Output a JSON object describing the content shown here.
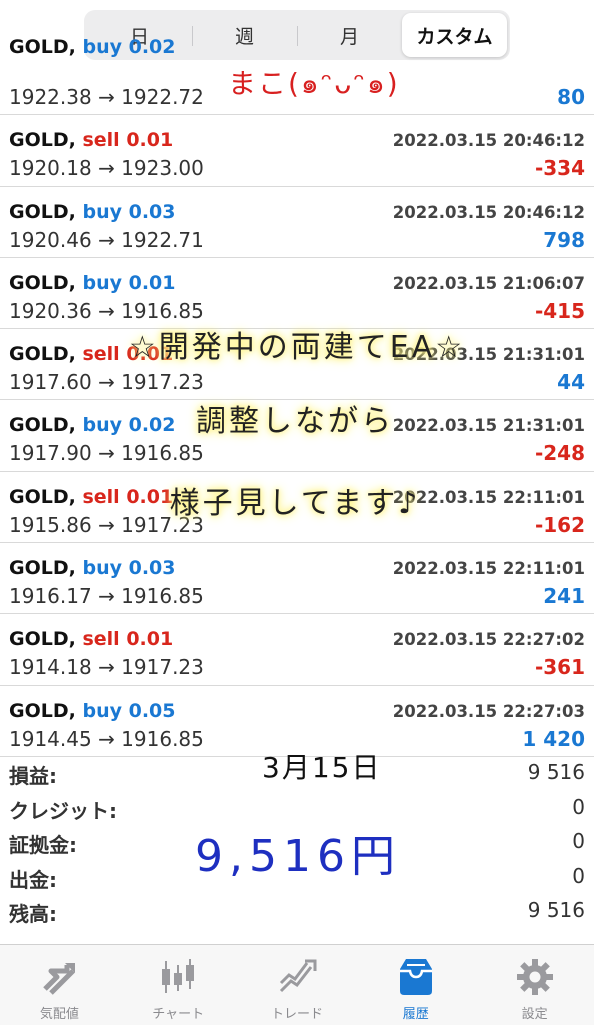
{
  "segments": [
    {
      "label": "日",
      "active": false
    },
    {
      "label": "週",
      "active": false
    },
    {
      "label": "月",
      "active": false
    },
    {
      "label": "カスタム",
      "active": true
    }
  ],
  "trades": [
    {
      "symbol": "GOLD,",
      "side": "buy",
      "lots": "0.02",
      "time": "",
      "prices": "1922.38 → 1922.72",
      "profit": "80",
      "sign": "pos"
    },
    {
      "symbol": "GOLD,",
      "side": "sell",
      "lots": "0.01",
      "time": "2022.03.15 20:46:12",
      "prices": "1920.18 → 1923.00",
      "profit": "-334",
      "sign": "neg"
    },
    {
      "symbol": "GOLD,",
      "side": "buy",
      "lots": "0.03",
      "time": "2022.03.15 20:46:12",
      "prices": "1920.46 → 1922.71",
      "profit": "798",
      "sign": "pos"
    },
    {
      "symbol": "GOLD,",
      "side": "buy",
      "lots": "0.01",
      "time": "2022.03.15 21:06:07",
      "prices": "1920.36 → 1916.85",
      "profit": "-415",
      "sign": "neg"
    },
    {
      "symbol": "GOLD,",
      "side": "sell",
      "lots": "0.01",
      "time": "2022.03.15 21:31:01",
      "prices": "1917.60 → 1917.23",
      "profit": "44",
      "sign": "pos"
    },
    {
      "symbol": "GOLD,",
      "side": "buy",
      "lots": "0.02",
      "time": "2022.03.15 21:31:01",
      "prices": "1917.90 → 1916.85",
      "profit": "-248",
      "sign": "neg"
    },
    {
      "symbol": "GOLD,",
      "side": "sell",
      "lots": "0.01",
      "time": "2022.03.15 22:11:01",
      "prices": "1915.86 → 1917.23",
      "profit": "-162",
      "sign": "neg"
    },
    {
      "symbol": "GOLD,",
      "side": "buy",
      "lots": "0.03",
      "time": "2022.03.15 22:11:01",
      "prices": "1916.17 → 1916.85",
      "profit": "241",
      "sign": "pos"
    },
    {
      "symbol": "GOLD,",
      "side": "sell",
      "lots": "0.01",
      "time": "2022.03.15 22:27:02",
      "prices": "1914.18 → 1917.23",
      "profit": "-361",
      "sign": "neg"
    },
    {
      "symbol": "GOLD,",
      "side": "buy",
      "lots": "0.05",
      "time": "2022.03.15 22:27:03",
      "prices": "1914.45 → 1916.85",
      "profit": "1 420",
      "sign": "pos"
    }
  ],
  "summary": [
    {
      "label": "損益:",
      "value": "9 516"
    },
    {
      "label": "クレジット:",
      "value": "0"
    },
    {
      "label": "証拠金:",
      "value": "0"
    },
    {
      "label": "出金:",
      "value": "0"
    },
    {
      "label": "残高:",
      "value": "9 516"
    }
  ],
  "overlay": {
    "top_note": "まこ(๑ᵔᴗᵔ๑)",
    "line1": "☆開発中の両建てEA☆",
    "line2": "調整しながら",
    "line3": "様子見してます♪",
    "date_note": "3月15日",
    "yen_note": "9,516円"
  },
  "tabs": [
    {
      "label": "気配値",
      "icon": "quotes-icon",
      "active": false
    },
    {
      "label": "チャート",
      "icon": "chart-icon",
      "active": false
    },
    {
      "label": "トレード",
      "icon": "trade-icon",
      "active": false
    },
    {
      "label": "履歴",
      "icon": "history-icon",
      "active": true
    },
    {
      "label": "設定",
      "icon": "settings-icon",
      "active": false
    }
  ],
  "colors": {
    "buy": "#1a78d2",
    "sell": "#d8261c",
    "accent": "#1a78d2"
  }
}
